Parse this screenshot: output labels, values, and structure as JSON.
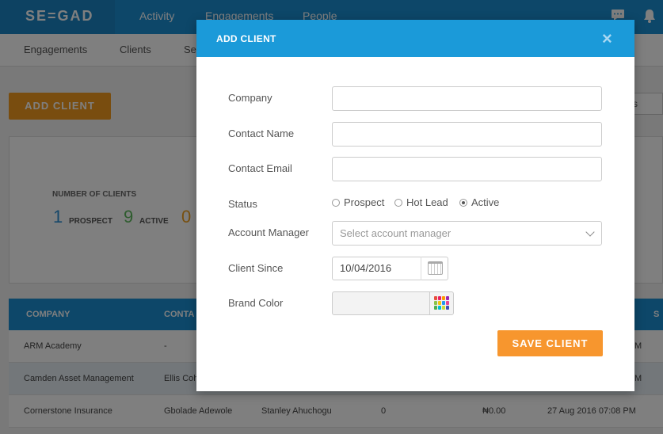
{
  "topnav": {
    "logo": "SE=GAD",
    "links": [
      "Activity",
      "Engagements",
      "People"
    ],
    "chat_icon": "chat-icon",
    "bell_icon": "bell-icon"
  },
  "subnav": {
    "links": [
      "Engagements",
      "Clients",
      "Se"
    ]
  },
  "background": {
    "add_client_label": "ADD CLIENT",
    "status_filter": "tus",
    "stats": {
      "title": "NUMBER OF CLIENTS",
      "prospect_count": "1",
      "prospect_label": "PROSPECT",
      "active_count": "9",
      "active_label": "ACTIVE",
      "hotlead_count": "0"
    },
    "table": {
      "headers": [
        "COMPANY",
        "CONTA",
        "S"
      ],
      "rows": [
        {
          "company": "ARM Academy",
          "contact": "-",
          "manager": "",
          "count": "",
          "amount": "",
          "date": "M"
        },
        {
          "company": "Camden Asset Management",
          "contact": "Ellis Coh",
          "manager": "",
          "count": "",
          "amount": "",
          "date": "M"
        },
        {
          "company": "Cornerstone Insurance",
          "contact": "Gbolade Adewole",
          "manager": "Stanley Ahuchogu",
          "count": "0",
          "amount": "₦0.00",
          "date": "27 Aug 2016 07:08 PM"
        }
      ]
    }
  },
  "modal": {
    "title": "ADD CLIENT",
    "close": "×",
    "fields": {
      "company_label": "Company",
      "company_value": "",
      "contact_name_label": "Contact Name",
      "contact_name_value": "",
      "contact_email_label": "Contact Email",
      "contact_email_value": "",
      "status_label": "Status",
      "status_options": [
        "Prospect",
        "Hot Lead",
        "Active"
      ],
      "status_selected": "Active",
      "account_manager_label": "Account Manager",
      "account_manager_placeholder": "Select account manager",
      "client_since_label": "Client Since",
      "client_since_value": "10/04/2016",
      "brand_color_label": "Brand Color"
    },
    "save_label": "SAVE CLIENT"
  },
  "colors": {
    "primary_blue": "#1b8ed3",
    "modal_header": "#1b9ad9",
    "orange": "#f7962e",
    "prospect_blue": "#2a8fd4",
    "active_green": "#5cb85c",
    "hotlead_orange": "#f0a020"
  }
}
